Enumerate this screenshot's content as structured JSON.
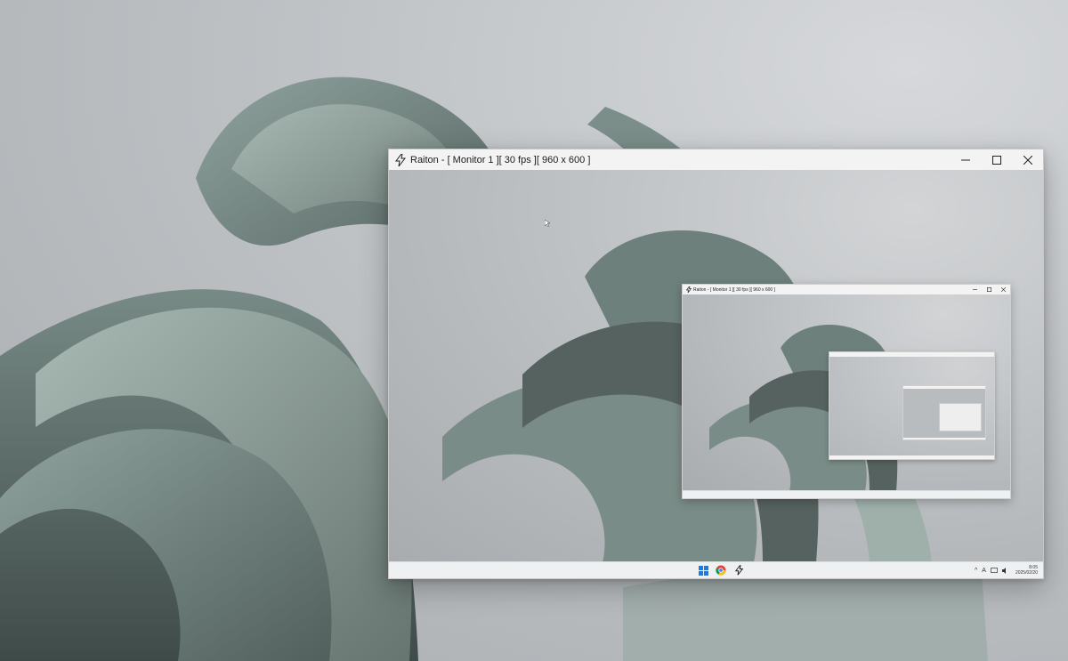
{
  "window": {
    "title": "Raiton - [ Monitor 1 ][ 30 fps ][ 960 x 600 ]",
    "minimize_icon": "minimize-icon",
    "maximize_icon": "maximize-icon",
    "close_icon": "close-icon",
    "app_icon": "lightning-icon"
  },
  "nested_window": {
    "title": "Raiton - [ Monitor 1 ][ 30 fps ][ 960 x 600 ]"
  },
  "taskbar": {
    "apps": [
      "windows-start-icon",
      "chrome-icon",
      "raiton-lightning-icon"
    ],
    "tray": {
      "chevron": "^",
      "ime": "A",
      "clock_time": "8:05",
      "clock_date": "2025/02/20"
    }
  },
  "colors": {
    "wallpaper_petal": "#7f9590",
    "wallpaper_shadow": "#4f5d5a",
    "window_chrome": "#f3f3f3",
    "taskbar": "#eef0f2"
  }
}
